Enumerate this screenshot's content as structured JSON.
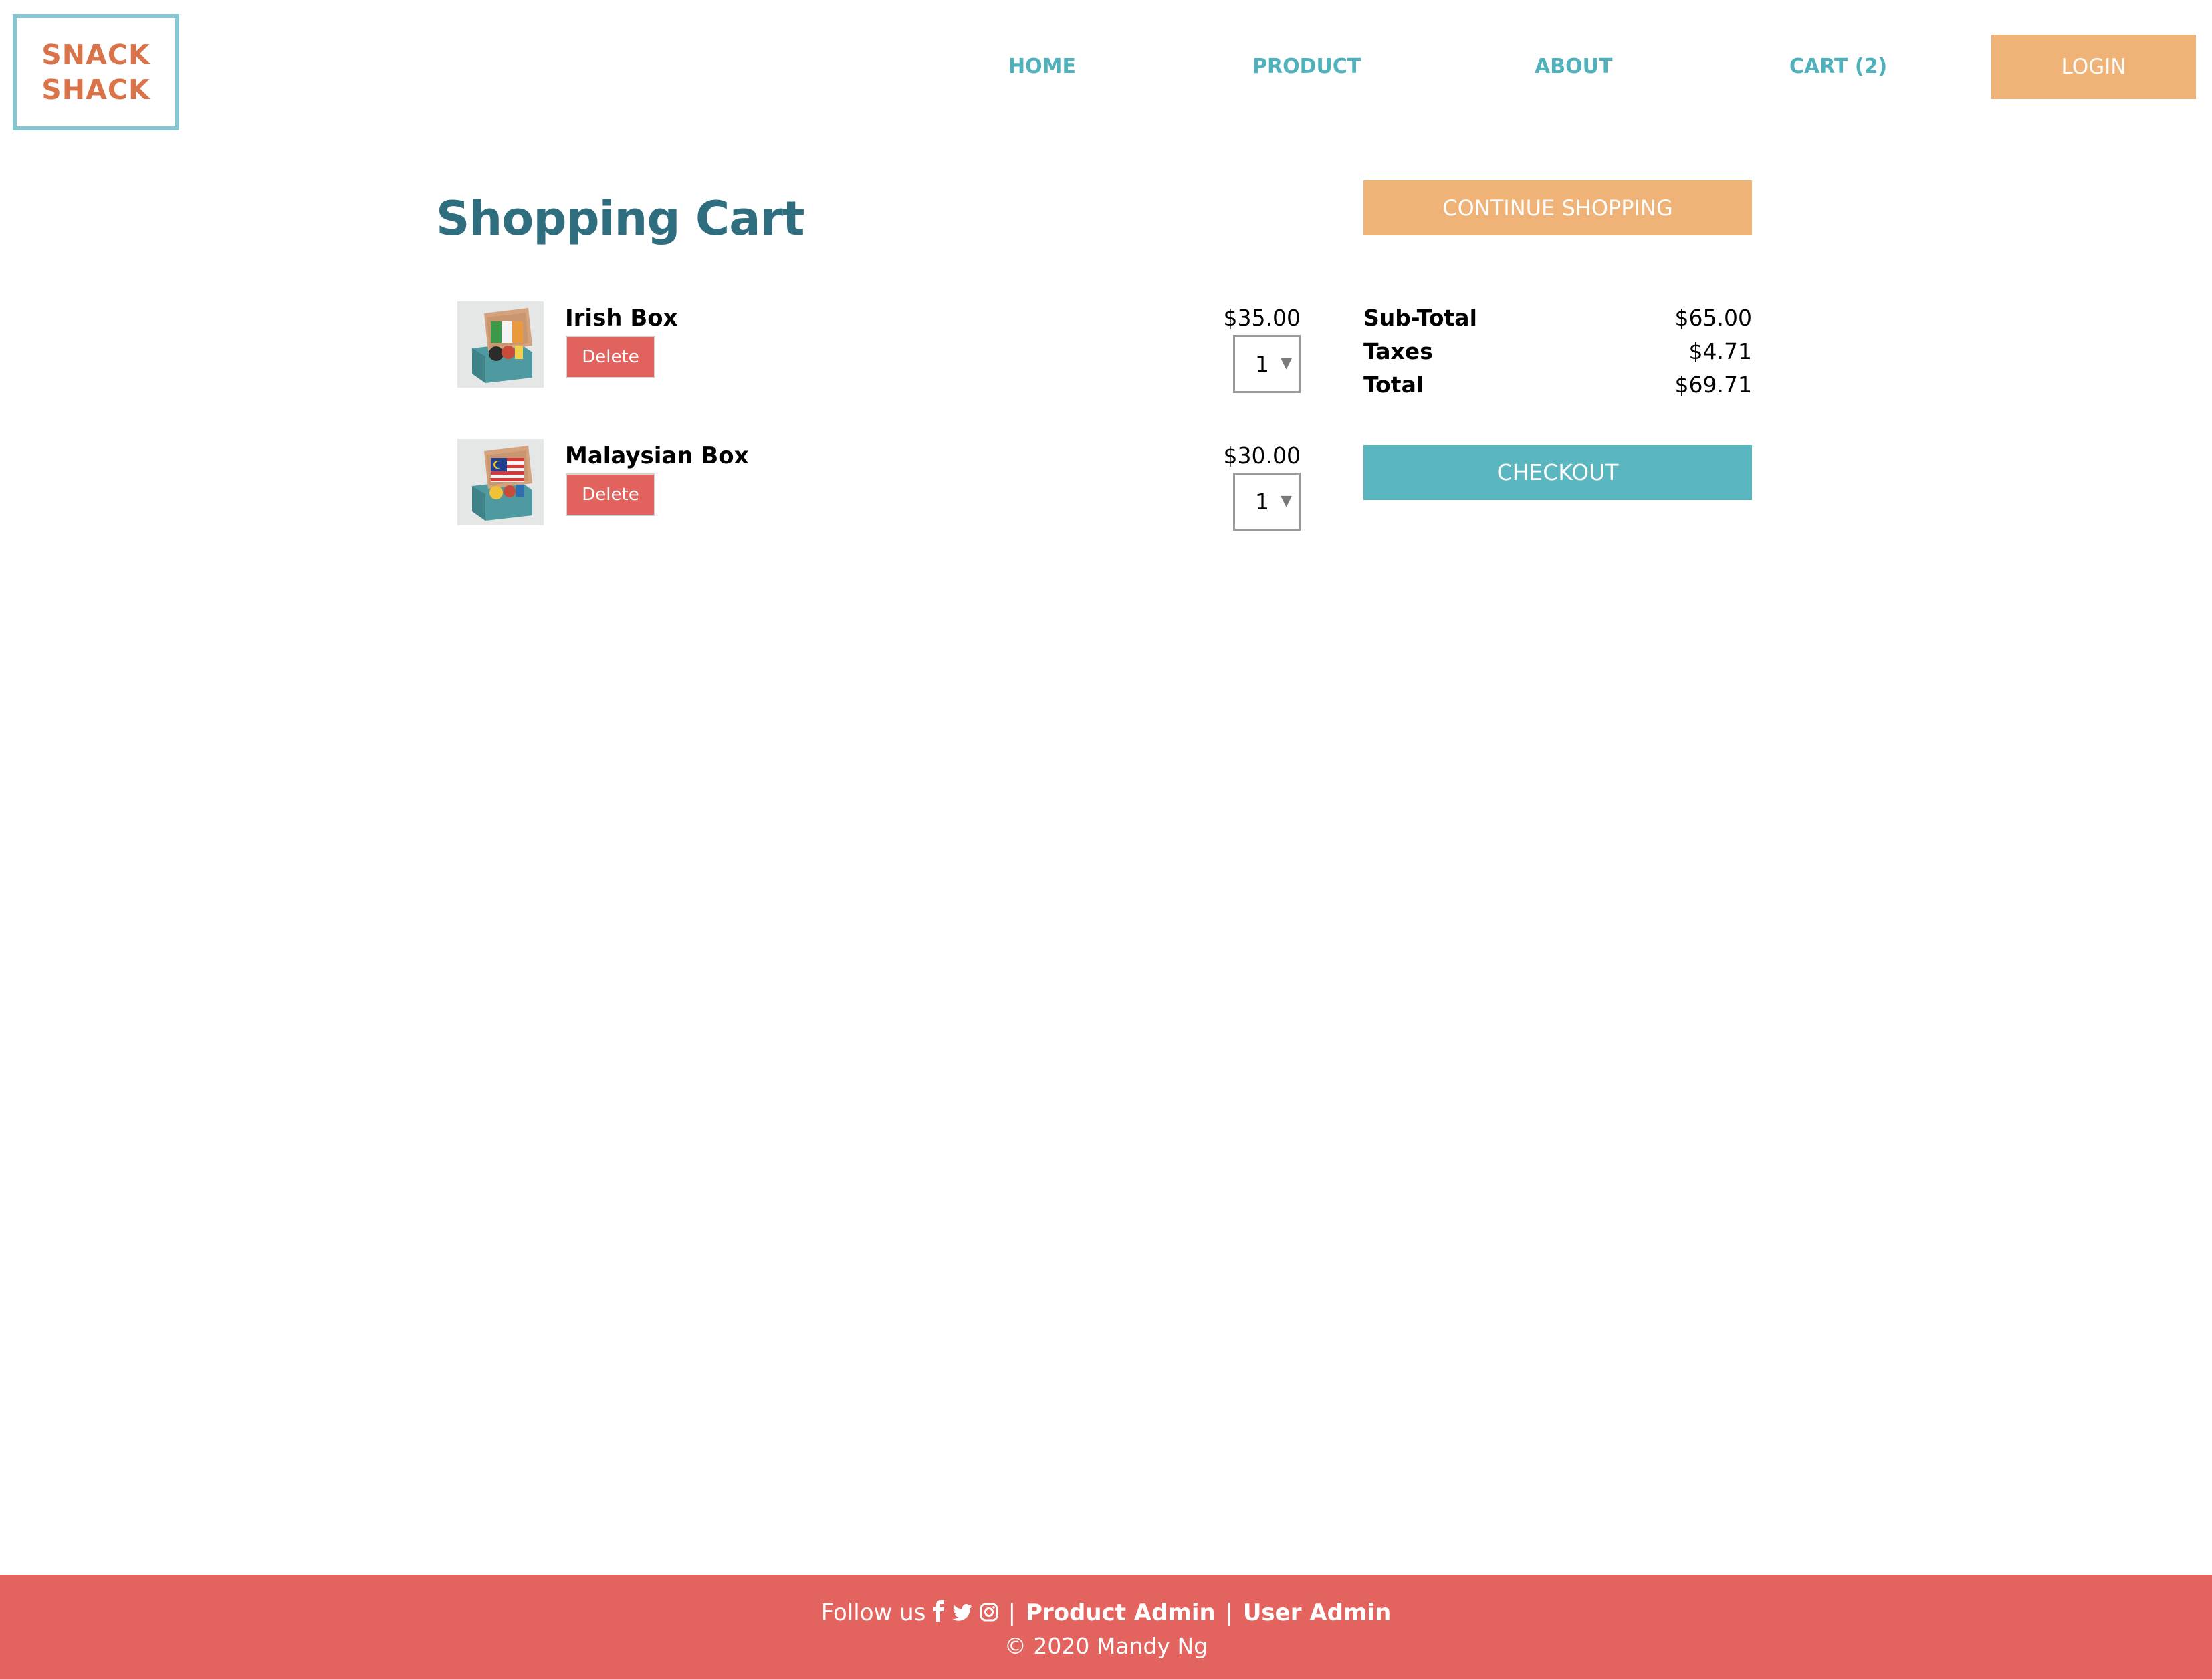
{
  "header": {
    "logo": {
      "line1": "SNACK",
      "line2": "SHACK"
    },
    "nav": {
      "home": "HOME",
      "product": "PRODUCT",
      "about": "ABOUT",
      "cart": "CART (2)"
    },
    "login_label": "LOGIN"
  },
  "main": {
    "title": "Shopping Cart",
    "continue_label": "CONTINUE SHOPPING",
    "items": [
      {
        "name": "Irish Box",
        "price": "$35.00",
        "quantity": "1",
        "delete_label": "Delete",
        "image_icon": "snack-box-ireland-flag-image"
      },
      {
        "name": "Malaysian Box",
        "price": "$30.00",
        "quantity": "1",
        "delete_label": "Delete",
        "image_icon": "snack-box-malaysia-flag-image"
      }
    ],
    "summary": {
      "subtotal_label": "Sub-Total",
      "subtotal_value": "$65.00",
      "taxes_label": "Taxes",
      "taxes_value": "$4.71",
      "total_label": "Total",
      "total_value": "$69.71"
    },
    "checkout_label": "CHECKOUT"
  },
  "footer": {
    "follow_text": "Follow us",
    "social_icons": [
      "facebook-icon",
      "twitter-icon",
      "instagram-icon"
    ],
    "separator": "|",
    "product_admin": "Product Admin",
    "user_admin": "User Admin",
    "copyright": "© 2020 Mandy Ng"
  },
  "colors": {
    "accent_orange": "#efb277",
    "teal_nav": "#4fb1bc",
    "checkout_teal": "#5bb7bf",
    "title_teal": "#2f6e7e",
    "delete_red": "#e2625e",
    "footer_red": "#e3635f",
    "logo_text": "#d9734a",
    "logo_border": "#86c6d3"
  }
}
